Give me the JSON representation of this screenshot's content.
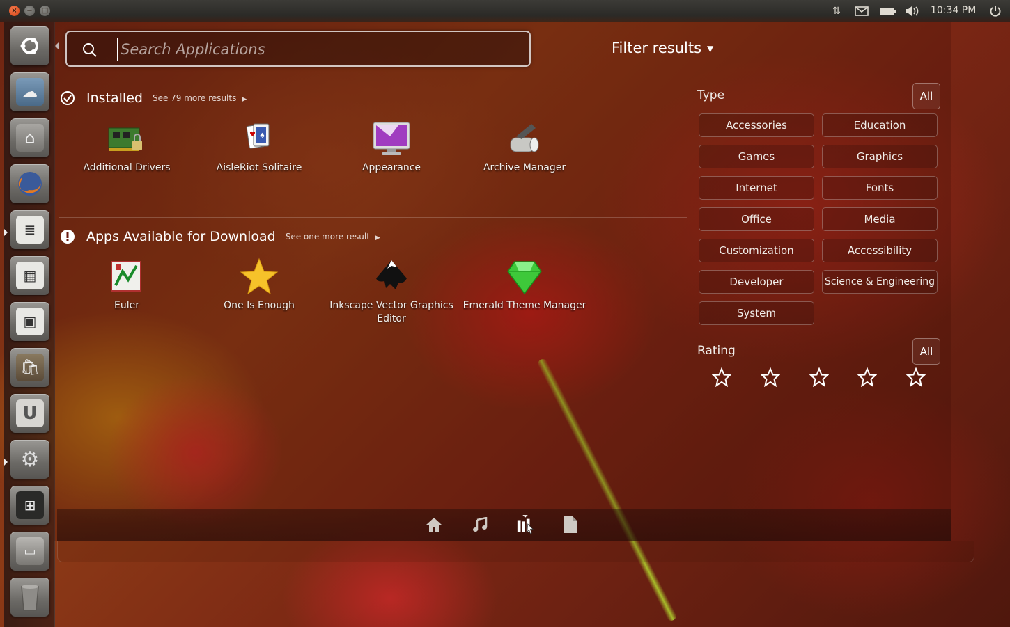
{
  "topbar": {
    "clock": "10:34 PM"
  },
  "search": {
    "placeholder": "Search Applications",
    "value": ""
  },
  "filter_toggle": "Filter results",
  "installed": {
    "title": "Installed",
    "more": "See 79 more results",
    "apps": [
      {
        "label": "Additional Drivers",
        "icon": "drivers-icon"
      },
      {
        "label": "AisleRiot Solitaire",
        "icon": "cards-icon"
      },
      {
        "label": "Appearance",
        "icon": "monitor-icon"
      },
      {
        "label": "Archive Manager",
        "icon": "archive-icon"
      }
    ]
  },
  "download": {
    "title": "Apps Available for Download",
    "more": "See one more result",
    "apps": [
      {
        "label": "Euler",
        "icon": "euler-icon"
      },
      {
        "label": "One Is Enough",
        "icon": "star-icon"
      },
      {
        "label": "Inkscape Vector Graphics Editor",
        "icon": "inkscape-icon"
      },
      {
        "label": "Emerald Theme Manager",
        "icon": "emerald-icon"
      }
    ]
  },
  "filters": {
    "type_title": "Type",
    "all_label": "All",
    "types": [
      "Accessories",
      "Education",
      "Games",
      "Graphics",
      "Internet",
      "Fonts",
      "Office",
      "Media",
      "Customization",
      "Accessibility",
      "Developer",
      "Science & Engineering",
      "System"
    ],
    "rating_title": "Rating",
    "rating_all_label": "All",
    "rating_stars": 5
  },
  "lenses": [
    "home-lens-icon",
    "music-lens-icon",
    "apps-lens-icon",
    "files-lens-icon"
  ],
  "colors": {
    "accent": "#dd4814",
    "panel": "#3c3b37"
  }
}
